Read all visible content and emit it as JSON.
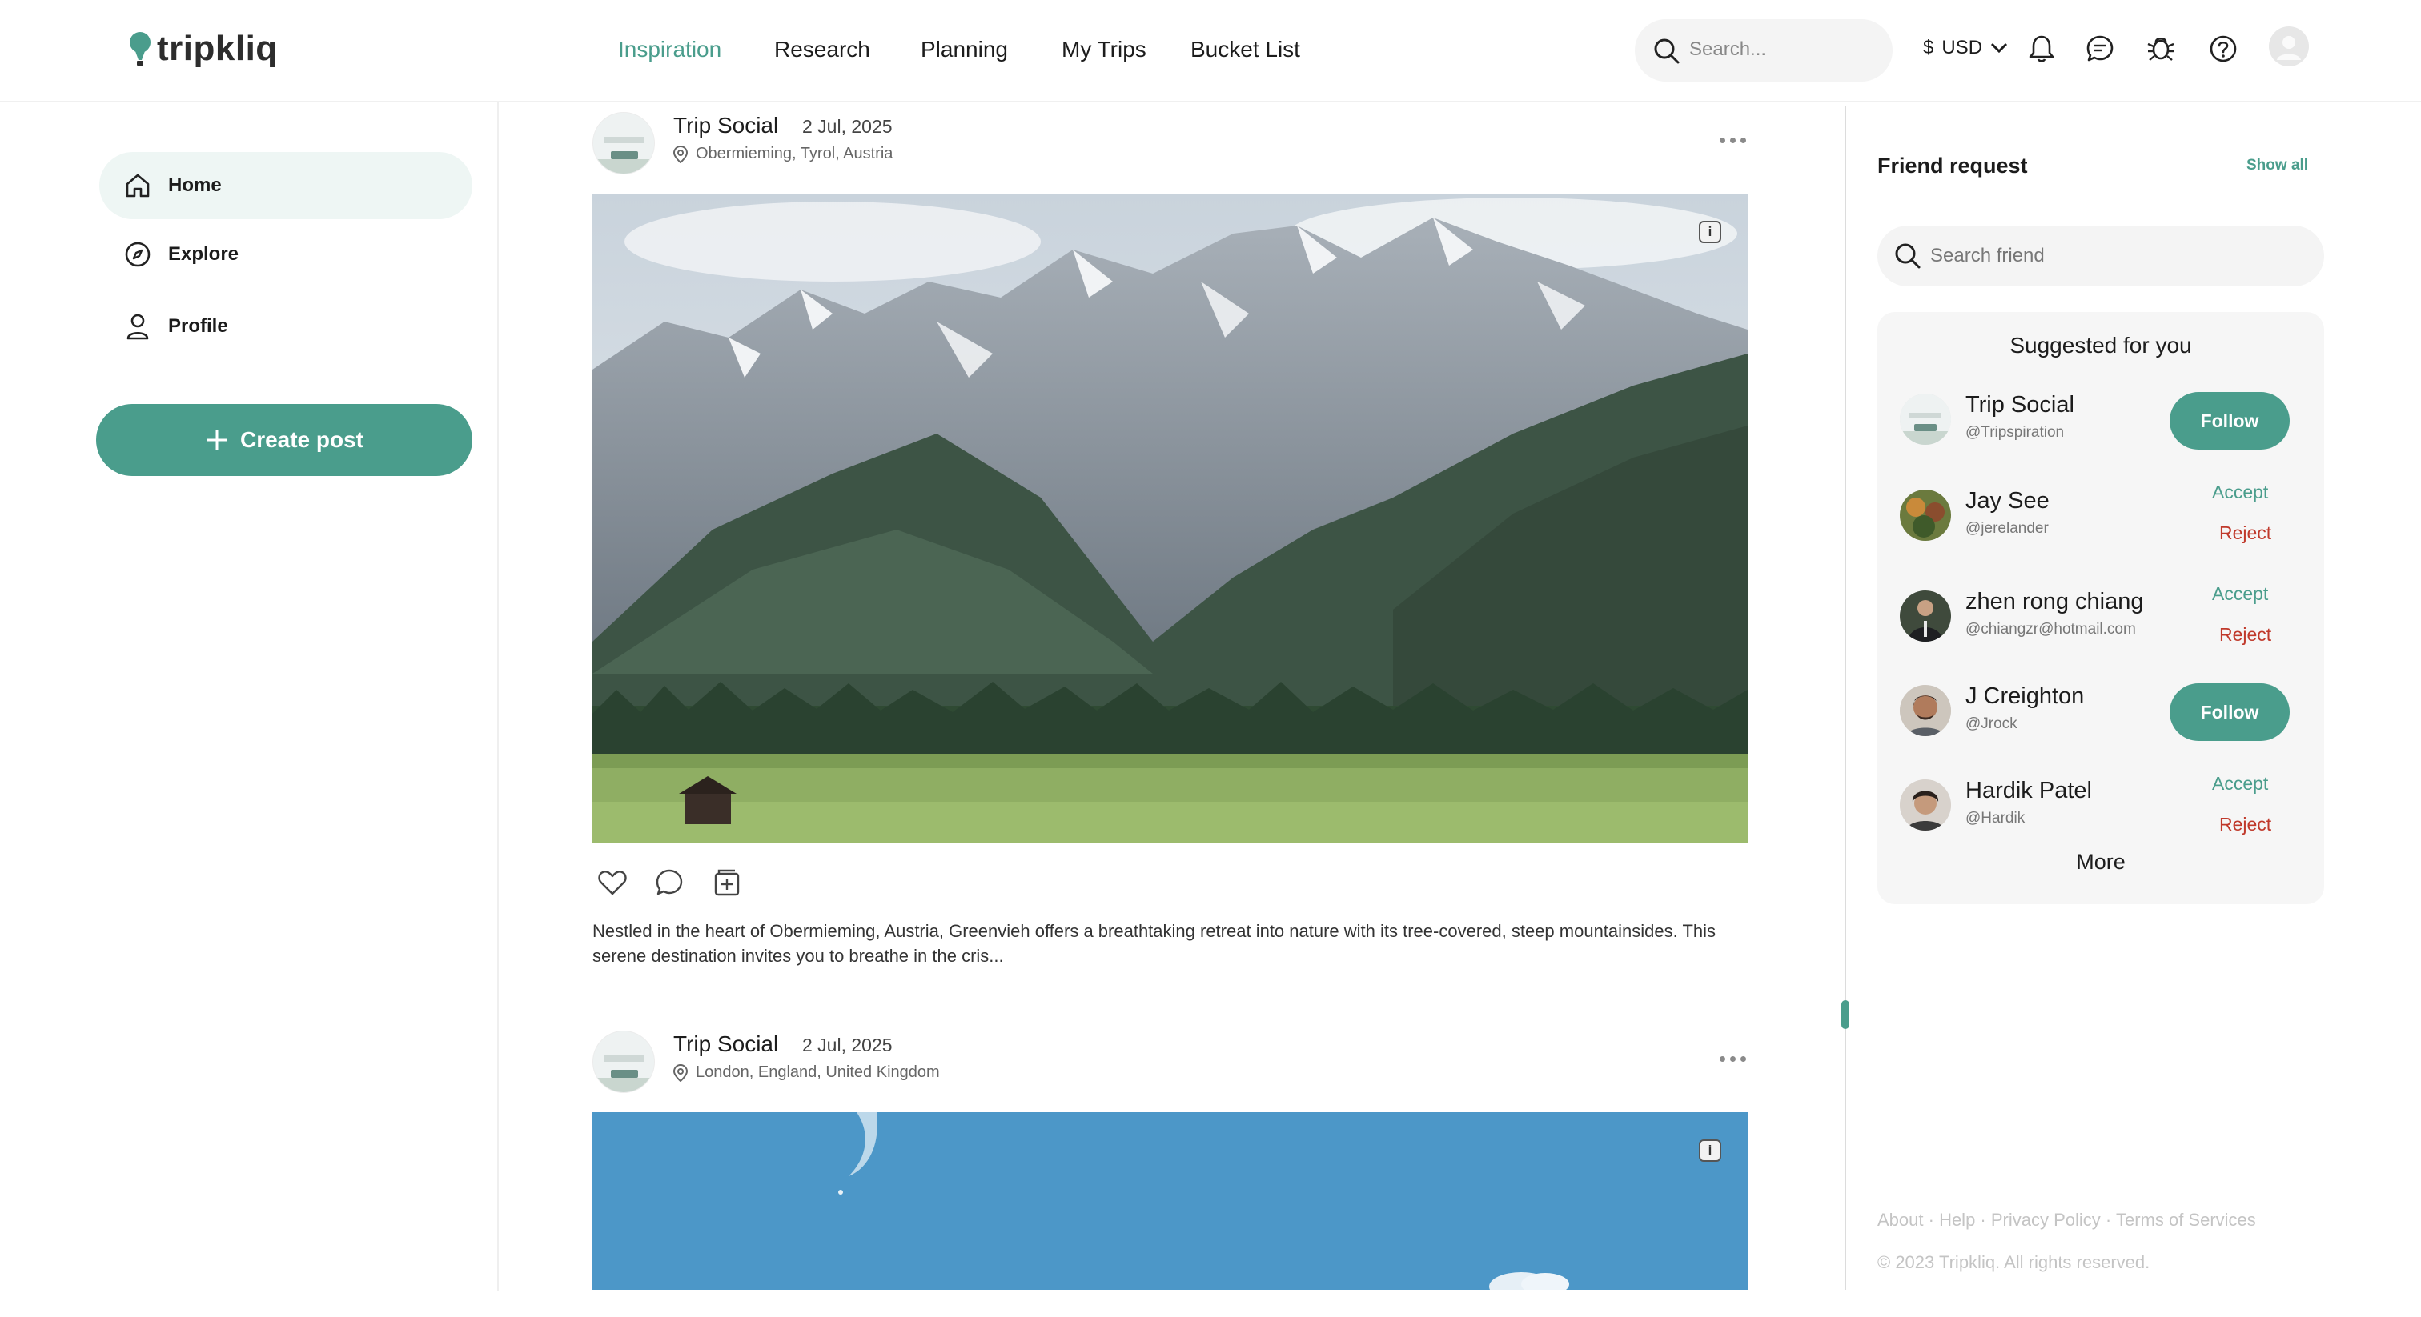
{
  "brand": {
    "name": "tripkliq",
    "accent_color": "#4a9d8c"
  },
  "nav": {
    "items": [
      {
        "label": "Inspiration",
        "active": true
      },
      {
        "label": "Research",
        "active": false
      },
      {
        "label": "Planning",
        "active": false
      },
      {
        "label": "My Trips",
        "active": false
      },
      {
        "label": "Bucket List",
        "active": false
      }
    ]
  },
  "header": {
    "search_placeholder": "Search...",
    "currency_symbol": "$",
    "currency_code": "USD",
    "icons": [
      "search-icon",
      "chevron-down-icon",
      "bell-icon",
      "chat-icon",
      "bug-icon",
      "help-icon",
      "avatar-placeholder"
    ]
  },
  "sidebar": {
    "items": [
      {
        "label": "Home",
        "icon": "home-icon",
        "active": true
      },
      {
        "label": "Explore",
        "icon": "compass-icon",
        "active": false
      },
      {
        "label": "Profile",
        "icon": "user-icon",
        "active": false
      }
    ],
    "create_post_label": "Create post"
  },
  "posts": [
    {
      "author": "Trip Social",
      "date": "2 Jul, 2025",
      "location": "Obermieming, Tyrol, Austria",
      "image_subject": "alpine-mountains-valley",
      "caption": "Nestled in the heart of Obermieming, Austria, Greenvieh offers a breathtaking retreat into nature with its tree-covered, steep mountainsides. This serene destination invites you to breathe in the cris..."
    },
    {
      "author": "Trip Social",
      "date": "2 Jul, 2025",
      "location": "London, England, United Kingdom",
      "image_subject": "blue-sky"
    }
  ],
  "friends": {
    "title": "Friend request",
    "show_all_label": "Show all",
    "search_placeholder": "Search friend",
    "suggested_title": "Suggested for you",
    "suggestions": [
      {
        "name": "Trip Social",
        "handle": "@Tripspiration",
        "action": "follow",
        "follow_label": "Follow"
      },
      {
        "name": "Jay See",
        "handle": "@jerelander",
        "action": "request",
        "accept_label": "Accept",
        "reject_label": "Reject"
      },
      {
        "name": "zhen rong chiang",
        "handle": "@chiangzr@hotmail.com",
        "action": "request",
        "accept_label": "Accept",
        "reject_label": "Reject"
      },
      {
        "name": "J Creighton",
        "handle": "@Jrock",
        "action": "follow",
        "follow_label": "Follow"
      },
      {
        "name": "Hardik Patel",
        "handle": "@Hardik",
        "action": "request",
        "accept_label": "Accept",
        "reject_label": "Reject"
      }
    ],
    "more_label": "More"
  },
  "footer": {
    "links": [
      "About",
      "Help",
      "Privacy Policy",
      "Terms of Services"
    ],
    "separator": " · ",
    "copyright": "© 2023 Tripkliq. All rights reserved."
  }
}
